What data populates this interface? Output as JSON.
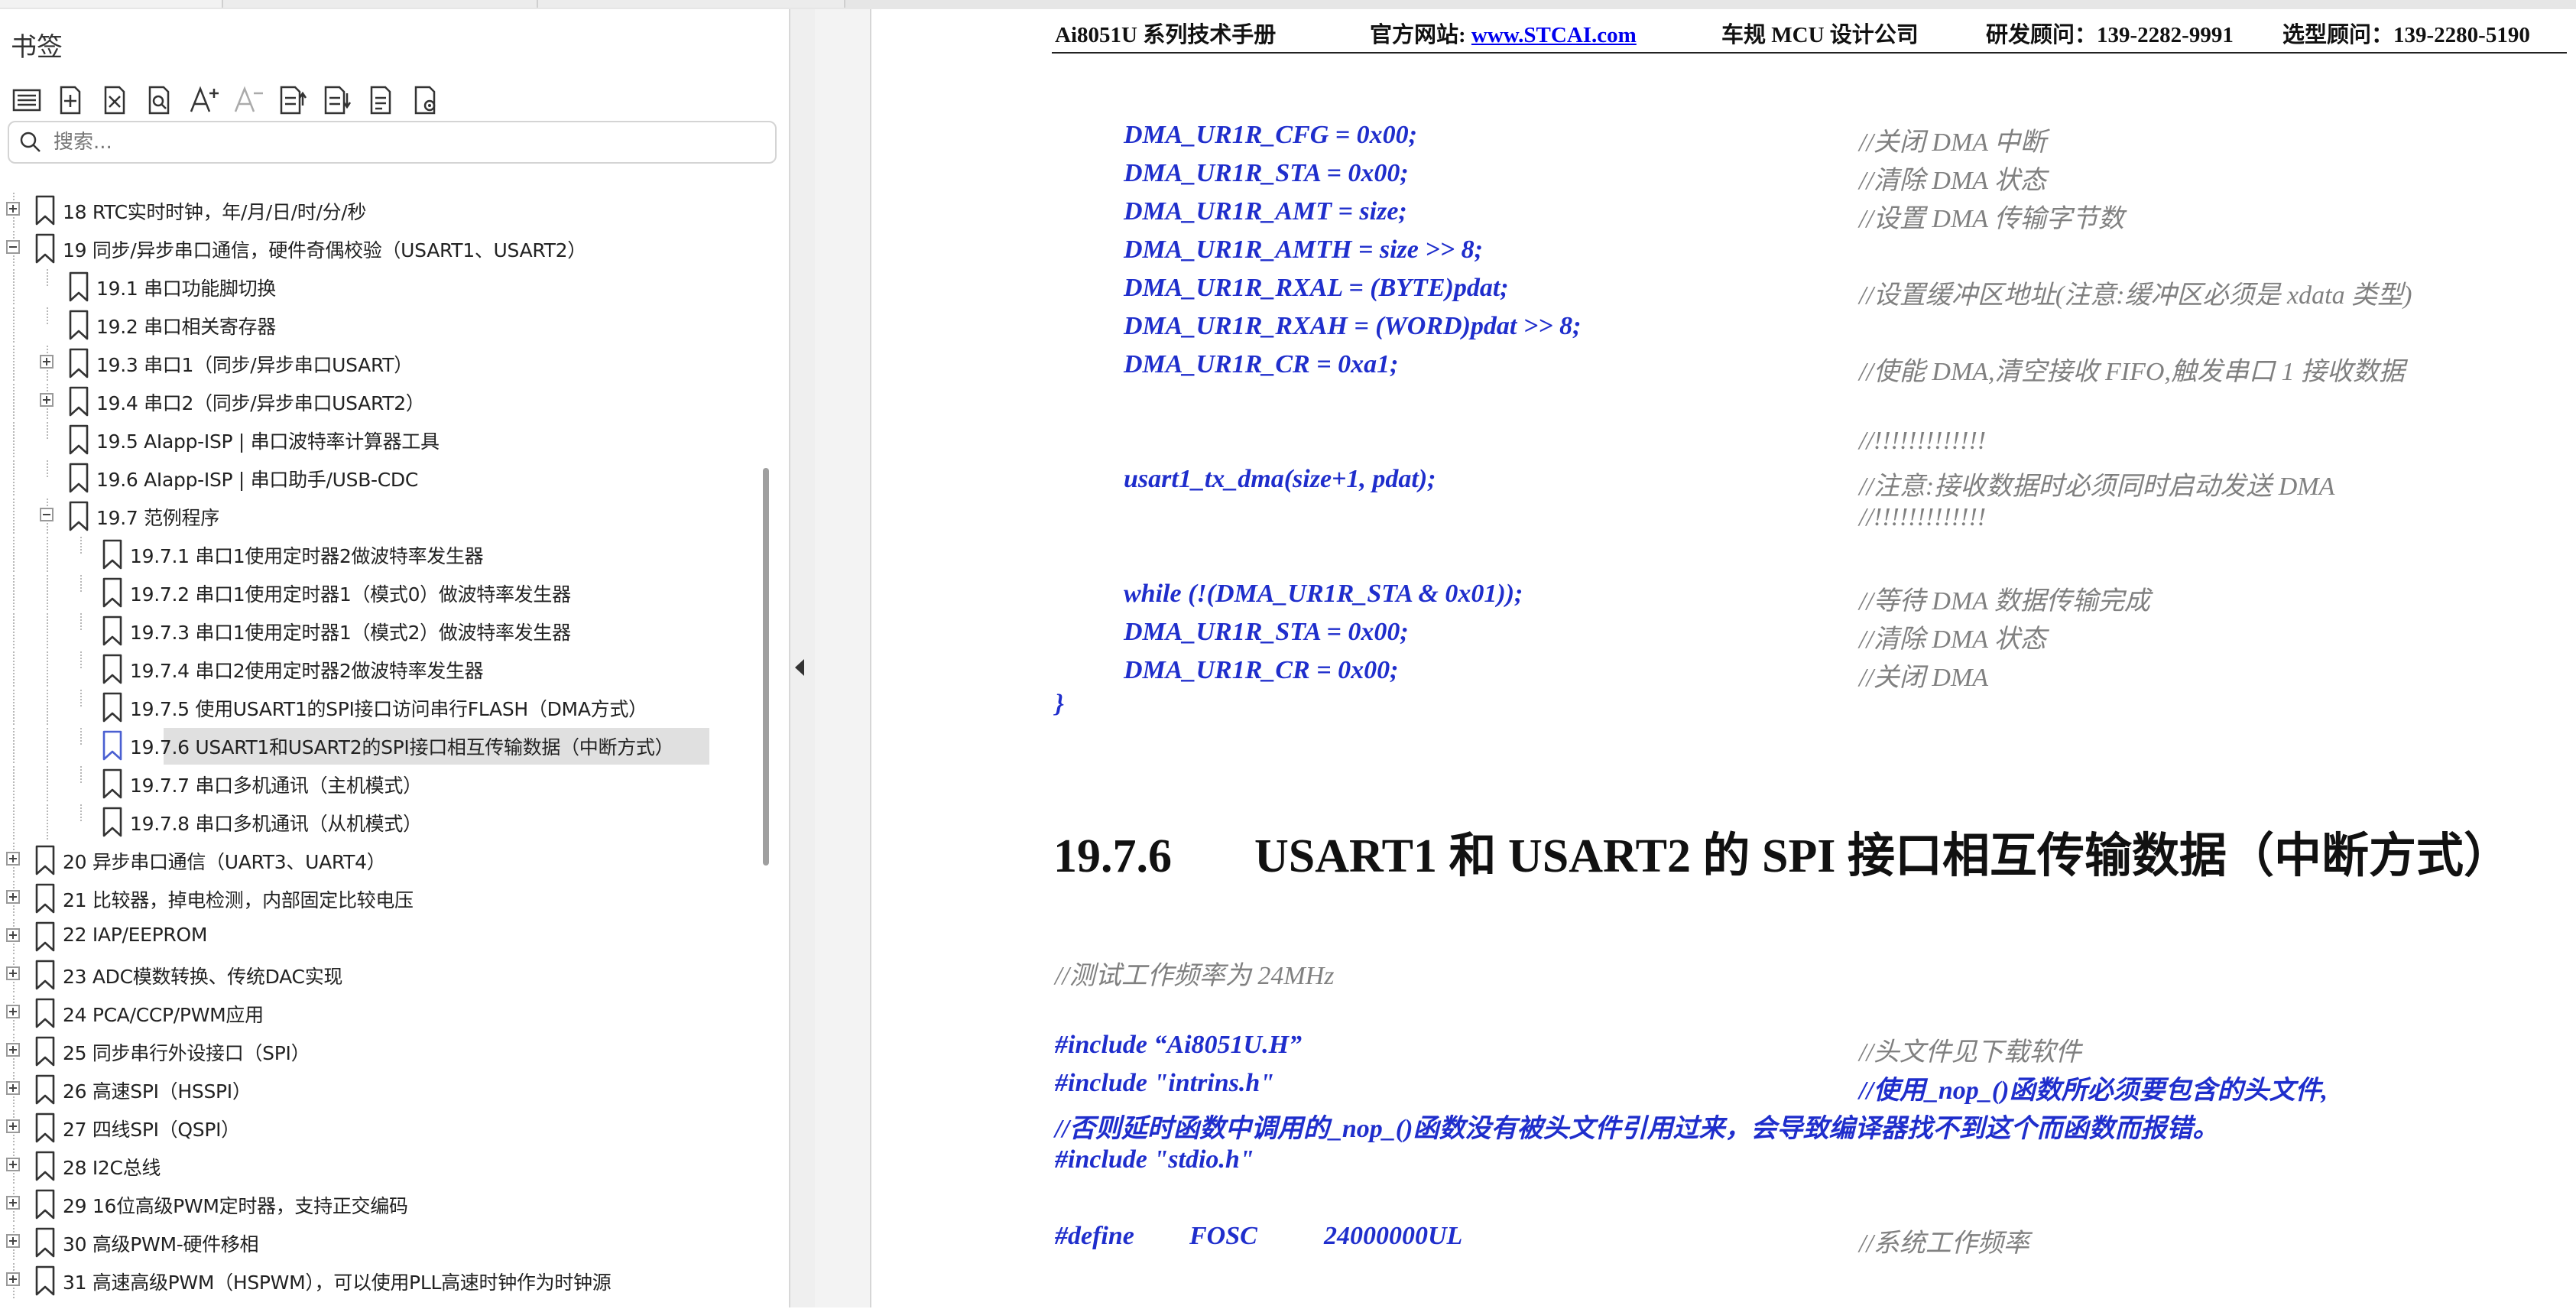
{
  "sidebar": {
    "title": "书签",
    "search": {
      "placeholder": "搜索...",
      "value": ""
    },
    "toolbar": [
      {
        "name": "outline-icon"
      },
      {
        "name": "add-bookmark-icon"
      },
      {
        "name": "delete-bookmark-icon"
      },
      {
        "name": "find-bookmark-icon"
      },
      {
        "name": "increase-text-size-icon"
      },
      {
        "name": "decrease-text-size-icon"
      },
      {
        "name": "expand-all-icon"
      },
      {
        "name": "collapse-all-icon"
      },
      {
        "name": "bookmark-properties-icon"
      },
      {
        "name": "bookmark-settings-icon"
      }
    ],
    "items": [
      {
        "level": 0,
        "expander": "plus",
        "label": "18  RTC实时时钟，年/月/日/时/分/秒"
      },
      {
        "level": 0,
        "expander": "minus",
        "label": "19  同步/异步串口通信，硬件奇偶校验（USART1、USART2）"
      },
      {
        "level": 1,
        "expander": "",
        "label": "19.1  串口功能脚切换"
      },
      {
        "level": 1,
        "expander": "",
        "label": "19.2  串口相关寄存器"
      },
      {
        "level": 1,
        "expander": "plus",
        "label": "19.3  串口1（同步/异步串口USART）"
      },
      {
        "level": 1,
        "expander": "plus",
        "label": "19.4  串口2（同步/异步串口USART2）"
      },
      {
        "level": 1,
        "expander": "",
        "label": "19.5  AIapp-ISP | 串口波特率计算器工具"
      },
      {
        "level": 1,
        "expander": "",
        "label": "19.6  AIapp-ISP | 串口助手/USB-CDC"
      },
      {
        "level": 1,
        "expander": "minus",
        "label": "19.7  范例程序"
      },
      {
        "level": 2,
        "expander": "",
        "label": "19.7.1 串口1使用定时器2做波特率发生器"
      },
      {
        "level": 2,
        "expander": "",
        "label": "19.7.2 串口1使用定时器1（模式0）做波特率发生器"
      },
      {
        "level": 2,
        "expander": "",
        "label": "19.7.3 串口1使用定时器1（模式2）做波特率发生器"
      },
      {
        "level": 2,
        "expander": "",
        "label": "19.7.4 串口2使用定时器2做波特率发生器"
      },
      {
        "level": 2,
        "expander": "",
        "label": "19.7.5 使用USART1的SPI接口访问串行FLASH（DMA方式）"
      },
      {
        "level": 2,
        "expander": "",
        "label": "19.7.6 USART1和USART2的SPI接口相互传输数据（中断方式）",
        "selected": true
      },
      {
        "level": 2,
        "expander": "",
        "label": "19.7.7  串口多机通讯（主机模式）"
      },
      {
        "level": 2,
        "expander": "",
        "label": "19.7.8  串口多机通讯（从机模式）"
      },
      {
        "level": 0,
        "expander": "plus",
        "label": "20  异步串口通信（UART3、UART4）"
      },
      {
        "level": 0,
        "expander": "plus",
        "label": "21  比较器，掉电检测，内部固定比较电压"
      },
      {
        "level": 0,
        "expander": "plus",
        "label": "22  IAP/EEPROM"
      },
      {
        "level": 0,
        "expander": "plus",
        "label": "23  ADC模数转换、传统DAC实现"
      },
      {
        "level": 0,
        "expander": "plus",
        "label": "24  PCA/CCP/PWM应用"
      },
      {
        "level": 0,
        "expander": "plus",
        "label": "25  同步串行外设接口（SPI）"
      },
      {
        "level": 0,
        "expander": "plus",
        "label": "26  高速SPI（HSSPI）"
      },
      {
        "level": 0,
        "expander": "plus",
        "label": "27  四线SPI（QSPI）"
      },
      {
        "level": 0,
        "expander": "plus",
        "label": "28  I2C总线"
      },
      {
        "level": 0,
        "expander": "plus",
        "label": "29  16位高级PWM定时器，支持正交编码"
      },
      {
        "level": 0,
        "expander": "plus",
        "label": "30  高级PWM-硬件移相"
      },
      {
        "level": 0,
        "expander": "plus",
        "label": "31  高速高级PWM（HSPWM），可以使用PLL高速时钟作为时钟源"
      }
    ]
  },
  "doc": {
    "header": {
      "manual": "Ai8051U 系列技术手册",
      "site_label": "官方网站: ",
      "site_url": "www.STCAI.com",
      "company": "车规 MCU 设计公司",
      "rd": "研发顾问：139-2282-9991",
      "sel": "选型顾问：139-2280-5190"
    },
    "code_top": [
      {
        "code": "DMA_UR1R_CFG = 0x00;",
        "comment": "//关闭 DMA 中断"
      },
      {
        "code": "DMA_UR1R_STA = 0x00;",
        "comment": "//清除 DMA 状态"
      },
      {
        "code": "DMA_UR1R_AMT = size;",
        "comment": "//设置 DMA 传输字节数"
      },
      {
        "code": "DMA_UR1R_AMTH = size >> 8;",
        "comment": ""
      },
      {
        "code": "DMA_UR1R_RXAL = (BYTE)pdat;",
        "comment": "//设置缓冲区地址(注意:缓冲区必须是 xdata 类型)"
      },
      {
        "code": "DMA_UR1R_RXAH = (WORD)pdat >> 8;",
        "comment": ""
      },
      {
        "code": "DMA_UR1R_CR = 0xa1;",
        "comment": "//使能 DMA,清空接收 FIFO,触发串口 1 接收数据"
      },
      {
        "code": "",
        "comment": ""
      },
      {
        "code": "",
        "comment": "//!!!!!!!!!!!!!"
      },
      {
        "code": "usart1_tx_dma(size+1, pdat);",
        "comment": "//注意:接收数据时必须同时启动发送 DMA"
      },
      {
        "code": "",
        "comment": "//!!!!!!!!!!!!!"
      },
      {
        "code": "",
        "comment": ""
      },
      {
        "code": "while (!(DMA_UR1R_STA & 0x01));",
        "comment": "//等待 DMA 数据传输完成"
      },
      {
        "code": "DMA_UR1R_STA = 0x00;",
        "comment": "//清除 DMA 状态"
      },
      {
        "code": "DMA_UR1R_CR = 0x00;",
        "comment": "//关闭 DMA"
      }
    ],
    "closing_brace": "}",
    "section_number": "19.7.6",
    "section_title": "USART1 和 USART2 的 SPI 接口相互传输数据（中断方式）",
    "test_freq": "//测试工作频率为 24MHz",
    "include1": "#include “Ai8051U.H”",
    "include1_comment": "//头文件见下载软件",
    "include2": "#include \"intrins.h\"",
    "include2_comment": "//使用_nop_()函数所必须要包含的头文件,",
    "include2_note": "//否则延时函数中调用的_nop_()函数没有被头文件引用过来，会导致编译器找不到这个而函数而报错。",
    "include3": "#include \"stdio.h\"",
    "define_kw": "#define",
    "define_name": "FOSC",
    "define_value": "24000000UL",
    "define_comment": "//系统工作频率"
  }
}
